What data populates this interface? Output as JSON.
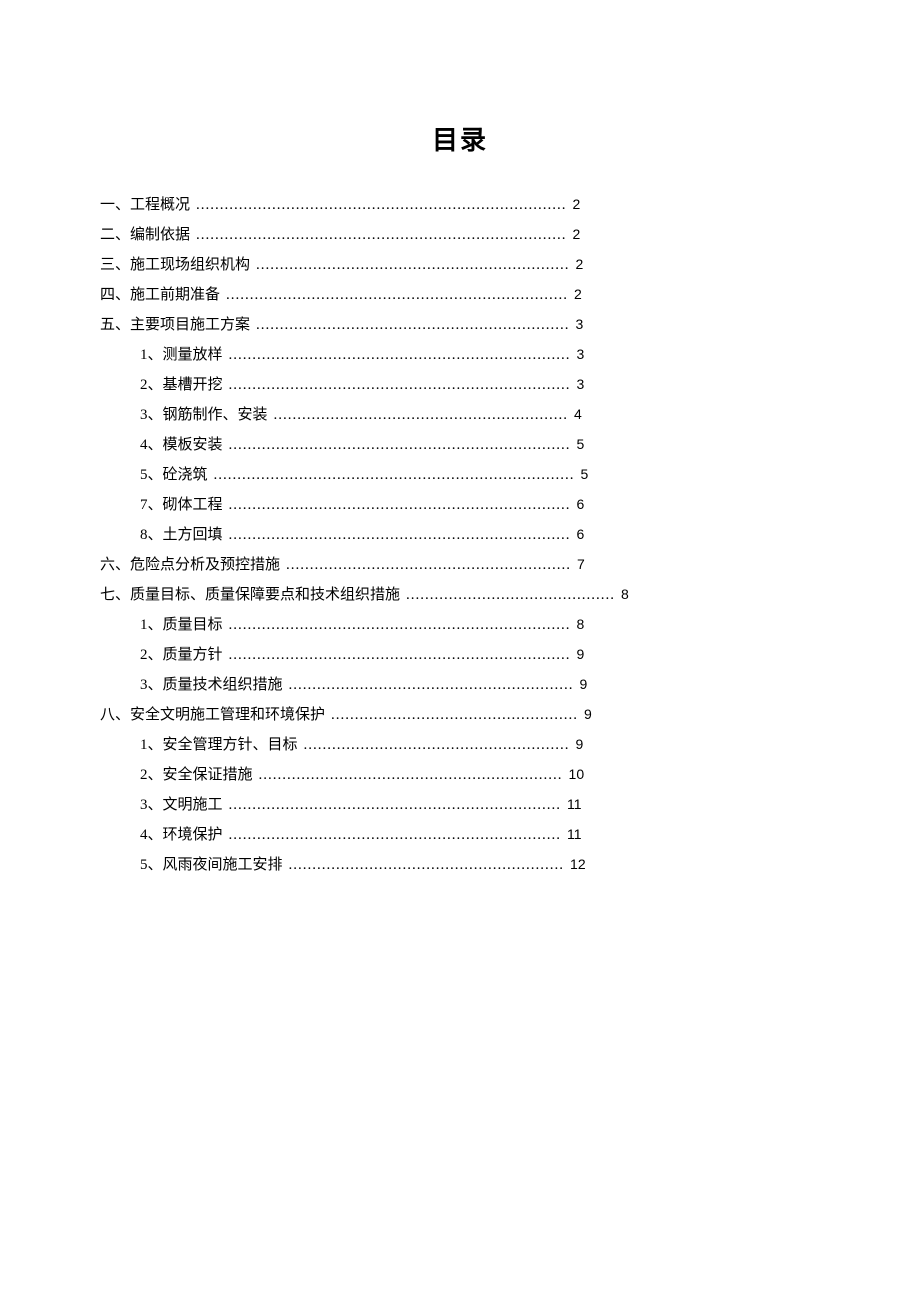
{
  "title": "目录",
  "toc": [
    {
      "level": 1,
      "ordinal": "一、",
      "label": "工程概况",
      "dots": 78,
      "page": "2"
    },
    {
      "level": 1,
      "ordinal": "二、",
      "label": "编制依据",
      "dots": 78,
      "page": "2"
    },
    {
      "level": 1,
      "ordinal": "三、",
      "label": "施工现场组织机构",
      "dots": 66,
      "page": "2"
    },
    {
      "level": 1,
      "ordinal": "四、",
      "label": "施工前期准备",
      "dots": 72,
      "page": "2"
    },
    {
      "level": 1,
      "ordinal": "五、",
      "label": "主要项目施工方案",
      "dots": 66,
      "page": "3"
    },
    {
      "level": 2,
      "ordinal": "1、",
      "label": "测量放样",
      "dots": 72,
      "page": "3"
    },
    {
      "level": 2,
      "ordinal": "2、",
      "label": "基槽开挖",
      "dots": 72,
      "page": "3"
    },
    {
      "level": 2,
      "ordinal": "3、",
      "label": "钢筋制作、安装",
      "dots": 62,
      "page": "4"
    },
    {
      "level": 2,
      "ordinal": "4、",
      "label": "模板安装",
      "dots": 72,
      "page": "5"
    },
    {
      "level": 2,
      "ordinal": "5、",
      "label": "砼浇筑",
      "dots": 76,
      "page": "5"
    },
    {
      "level": 2,
      "ordinal": "7、",
      "label": "砌体工程",
      "dots": 72,
      "page": "6"
    },
    {
      "level": 2,
      "ordinal": "8、",
      "label": "土方回填",
      "dots": 72,
      "page": "6"
    },
    {
      "level": 1,
      "ordinal": "六、",
      "label": "危险点分析及预控措施",
      "dots": 60,
      "page": "7"
    },
    {
      "level": 1,
      "ordinal": "七、",
      "label": "质量目标、质量保障要点和技术组织措施",
      "dots": 44,
      "page": "8"
    },
    {
      "level": 2,
      "ordinal": "1、",
      "label": "质量目标",
      "dots": 72,
      "page": "8"
    },
    {
      "level": 2,
      "ordinal": "2、",
      "label": "质量方针",
      "dots": 72,
      "page": "9"
    },
    {
      "level": 2,
      "ordinal": "3、",
      "label": "质量技术组织措施",
      "dots": 60,
      "page": "9"
    },
    {
      "level": 1,
      "ordinal": "八、",
      "label": "安全文明施工管理和环境保护",
      "dots": 52,
      "page": "9"
    },
    {
      "level": 2,
      "ordinal": "1、",
      "label": "安全管理方针、目标",
      "dots": 56,
      "page": "9"
    },
    {
      "level": 2,
      "ordinal": "2、",
      "label": "安全保证措施",
      "dots": 64,
      "page": "10"
    },
    {
      "level": 2,
      "ordinal": "3、",
      "label": "文明施工",
      "dots": 70,
      "page": "11"
    },
    {
      "level": 2,
      "ordinal": "4、",
      "label": "环境保护",
      "dots": 70,
      "page": "11"
    },
    {
      "level": 2,
      "ordinal": "5、",
      "label": "风雨夜间施工安排",
      "dots": 58,
      "page": "12"
    }
  ]
}
